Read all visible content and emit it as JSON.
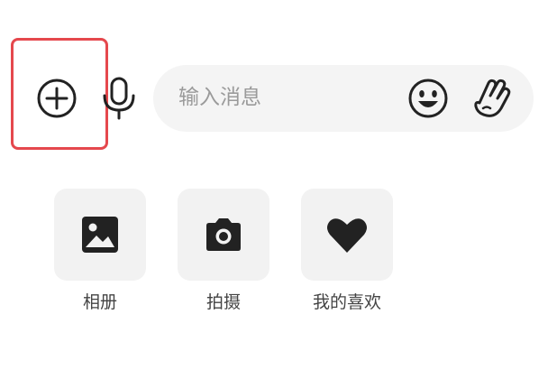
{
  "composer": {
    "input_placeholder": "输入消息",
    "icons": {
      "plus": "plus-circle-icon",
      "mic": "microphone-icon",
      "emoji": "emoji-smile-icon",
      "wave": "waving-hand-icon"
    }
  },
  "panel": {
    "tools": [
      {
        "label": "相册",
        "icon": "image-icon"
      },
      {
        "label": "拍摄",
        "icon": "camera-icon"
      },
      {
        "label": "我的喜欢",
        "icon": "heart-icon"
      }
    ]
  },
  "colors": {
    "highlight": "#e5484d",
    "input_bg": "#f4f4f4",
    "tool_bg": "#f2f2f2",
    "icon": "#222222"
  }
}
